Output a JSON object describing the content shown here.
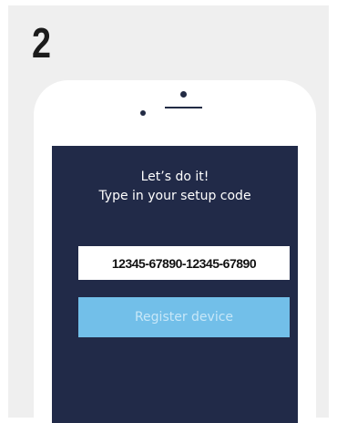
{
  "step": {
    "number": "2"
  },
  "screen": {
    "line1": "Let’s do it!",
    "line2": "Type in your setup code",
    "code_value": "12345-67890-12345-67890",
    "button_label": "Register device"
  },
  "colors": {
    "panel_background": "#efefef",
    "screen_background": "#212a48",
    "button_background": "#72bfe9",
    "button_text": "#c7e7f8"
  }
}
